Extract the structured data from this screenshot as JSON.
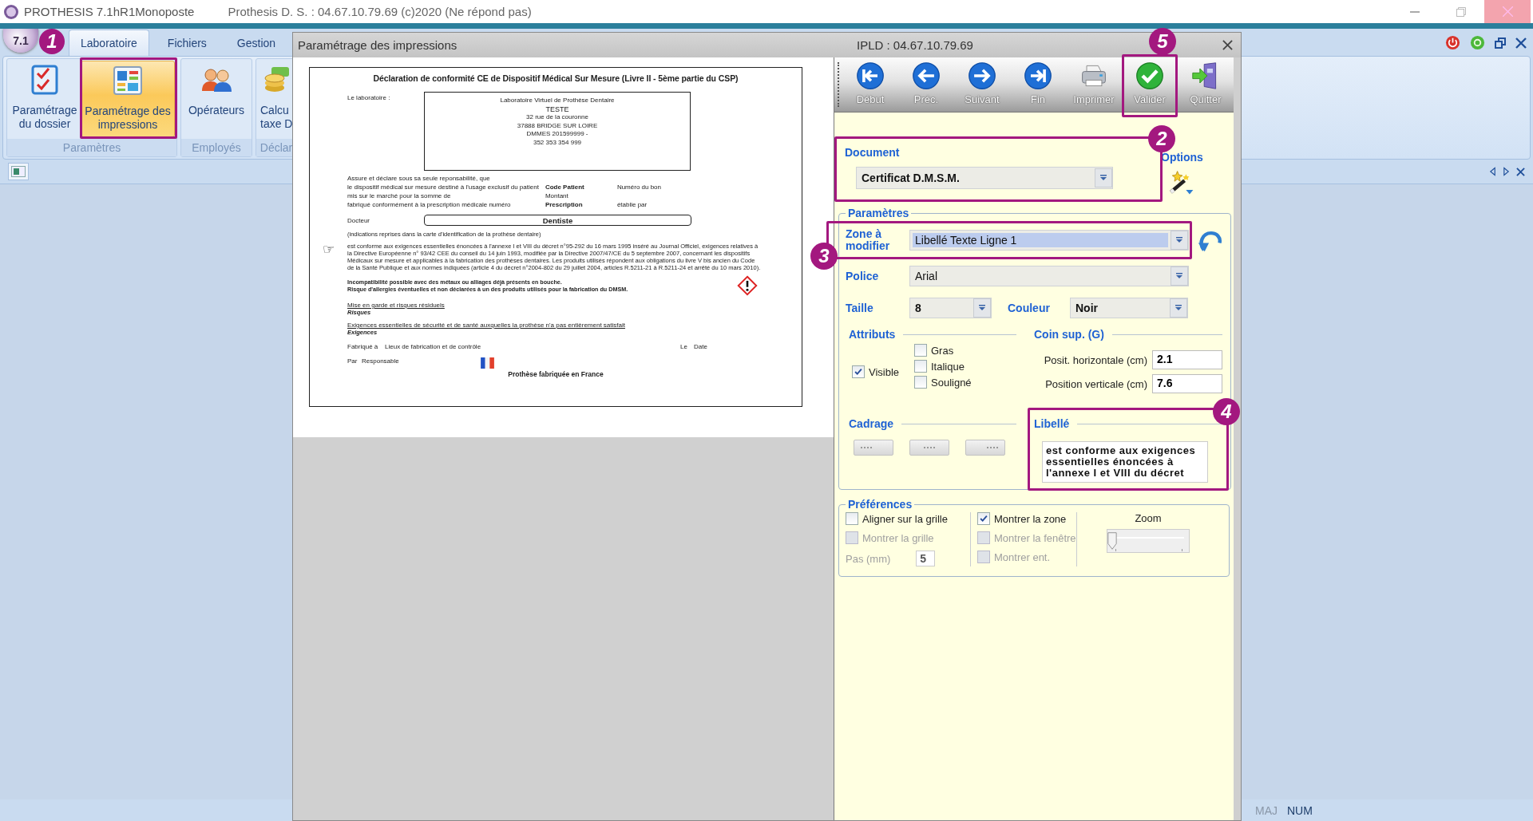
{
  "title_bar": {
    "app_title": "PROTHESIS 7.1hR1Monoposte",
    "subtitle": "Prothesis D. S. : 04.67.10.79.69 (c)2020 (Ne répond pas)"
  },
  "ribbon": {
    "orb_label": "7.1",
    "tabs": [
      {
        "label": "Laboratoire",
        "selected": true
      },
      {
        "label": "Fichiers",
        "selected": false
      },
      {
        "label": "Gestion",
        "selected": false
      }
    ],
    "groups": [
      {
        "title": "Paramètres",
        "buttons": [
          {
            "kind": "checklist",
            "label_lines": [
              "Paramétrage",
              "du dossier"
            ],
            "selected": false
          },
          {
            "kind": "layout",
            "label_lines": [
              "Paramétrage des",
              "impressions"
            ],
            "selected": true,
            "callout": "1"
          }
        ]
      },
      {
        "title": "Employés",
        "buttons": [
          {
            "kind": "people",
            "label_lines": [
              "Opérateurs"
            ],
            "selected": false
          }
        ]
      },
      {
        "title": "Déclar",
        "buttons": [
          {
            "kind": "coins",
            "label_lines": [
              "Calcu",
              "taxe D"
            ],
            "selected": false
          }
        ]
      }
    ]
  },
  "dialog": {
    "title": "Paramétrage des impressions",
    "host": "IPLD : 04.67.10.79.69",
    "document_preview": {
      "title": "Déclaration de conformité CE de Dispositif Médical Sur Mesure (Livre II - 5ème partie du CSP)",
      "lab_label": "Le laboratoire :",
      "lab_lines": [
        "Laboratoire Virtuel de Prothèse Dentaire",
        "TESTE",
        "32 rue de la couronne",
        "37888 BRIDGE SUR LOIRE",
        "DMMES 201599999 -",
        "352 353 354 999"
      ],
      "rows": [
        {
          "text": "Assure et déclare sous sa seule reponsabilité, que"
        },
        {
          "text": "le dispositif médical sur mesure destiné à l'usage exclusif du patient",
          "field": "Code Patient",
          "field_bold": true,
          "value": "Numéro du bon"
        },
        {
          "text": "mis sur le marché pour la somme de",
          "field": "Montant",
          "field_bold": false
        },
        {
          "text": "fabriqué conformément à la prescription médicale numéro",
          "field": "Prescription",
          "field_bold": true,
          "value": "établie par"
        }
      ],
      "doctor_label": "Docteur",
      "doctor": "Dentiste",
      "indications": "(indications reprises dans la carte d'identification de la prothèse dentaire)",
      "pointer": "☞",
      "paragraph": "est conforme aux exigences essentielles énoncées à l'annexe I et VIII du décret n°95-292 du 16 mars 1995 inséré au Journal Officiel, exigences relatives à la Directive Européenne n° 93/42 CEE  du conseil du 14 juin 1993, modifiée par la Directive 2007/47/CE du 5 septembre 2007, concernant les dispositifs Médicaux sur mesure et applicables à la fabrication des prothèses dentaires. Les produits utilisés répondent aux obligations du livre  V bis ancien du Code de la  Santé  Publique et aux normes indiquées (article 4 du décret n°2004-802 du 29 juillet 2004, articles R.5211-21 à R.5211-24 et arrêté du 10 mars 2010).",
      "warnings": [
        "Incompatibilité possible avec des métaux ou alliages déjà présents en bouche.",
        "Risque d'allergies éventuelles et non déclarées à un des produits utilisés pour la fabrication du DMSM."
      ],
      "sections": [
        {
          "heading": "Mise en garde et risques résiduels",
          "value": "Risques"
        },
        {
          "heading": "Exigences essentielles de sécurité et de santé auxquelles la prothèse n'a pas entièrement satisfait",
          "value": "Exigences"
        }
      ],
      "made_at_label": "Fabriqué à",
      "made_at": "Lieux de fabrication et de contrôle",
      "date_label": "Le",
      "date": "Date",
      "by_label": "Par",
      "by": "Responsable",
      "footer": "Prothèse fabriquée en France"
    },
    "toolbar": [
      {
        "kind": "first",
        "label": "Début"
      },
      {
        "kind": "prev",
        "label": "Préc."
      },
      {
        "kind": "next",
        "label": "Suivant"
      },
      {
        "kind": "last",
        "label": "Fin"
      },
      {
        "kind": "print",
        "label": "Imprimer"
      },
      {
        "kind": "validate",
        "label": "Valider",
        "callout": "5"
      },
      {
        "kind": "quit",
        "label": "Quitter"
      }
    ],
    "form": {
      "document": {
        "label": "Document",
        "value": "Certificat D.M.S.M.",
        "highlighted": false,
        "callout": "2"
      },
      "options": {
        "label": "Options"
      },
      "parametres": {
        "title": "Paramètres",
        "zone": {
          "label": "Zone à modifier",
          "value": "Libellé Texte Ligne 1",
          "highlighted": true,
          "callout": "3"
        },
        "police": {
          "label": "Police",
          "value": "Arial",
          "highlighted": false
        },
        "taille": {
          "label": "Taille",
          "value": "8",
          "highlighted": false
        },
        "couleur": {
          "label": "Couleur",
          "value": "Noir",
          "highlighted": false
        },
        "attributs": {
          "title": "Attributs",
          "checkboxes": [
            {
              "label": "Visible",
              "checked": true
            },
            {
              "label": "Gras",
              "checked": false
            },
            {
              "label": "Italique",
              "checked": false
            },
            {
              "label": "Souligné",
              "checked": false
            }
          ]
        },
        "coin": {
          "title": "Coin sup. (G)",
          "fields": [
            {
              "label": "Posit. horizontale (cm)",
              "value": "2.1"
            },
            {
              "label": "Position verticale (cm)",
              "value": "7.6"
            }
          ]
        },
        "cadrage": {
          "title": "Cadrage"
        },
        "libelle": {
          "title": "Libellé",
          "value": "est conforme aux exigences essentielles énoncées à l'annexe I et VIII du décret",
          "callout": "4"
        }
      },
      "preferences": {
        "title": "Préférences",
        "options": [
          {
            "label": "Aligner sur la grille",
            "checked": false,
            "disabled": false
          },
          {
            "label": "Montrer la grille",
            "checked": false,
            "disabled": true
          },
          {
            "label": "Montrer la zone",
            "checked": true,
            "disabled": false
          },
          {
            "label": "Montrer la fenêtre",
            "checked": false,
            "disabled": true
          },
          {
            "label": "Montrer ent.",
            "checked": false,
            "disabled": true
          }
        ],
        "pas": {
          "label": "Pas (mm)",
          "value": "5",
          "disabled": true
        },
        "zoom": {
          "label": "Zoom",
          "level": 0
        }
      }
    }
  },
  "status_bar": [
    {
      "label": "MAJ",
      "on": false
    },
    {
      "label": "NUM",
      "on": true
    }
  ]
}
